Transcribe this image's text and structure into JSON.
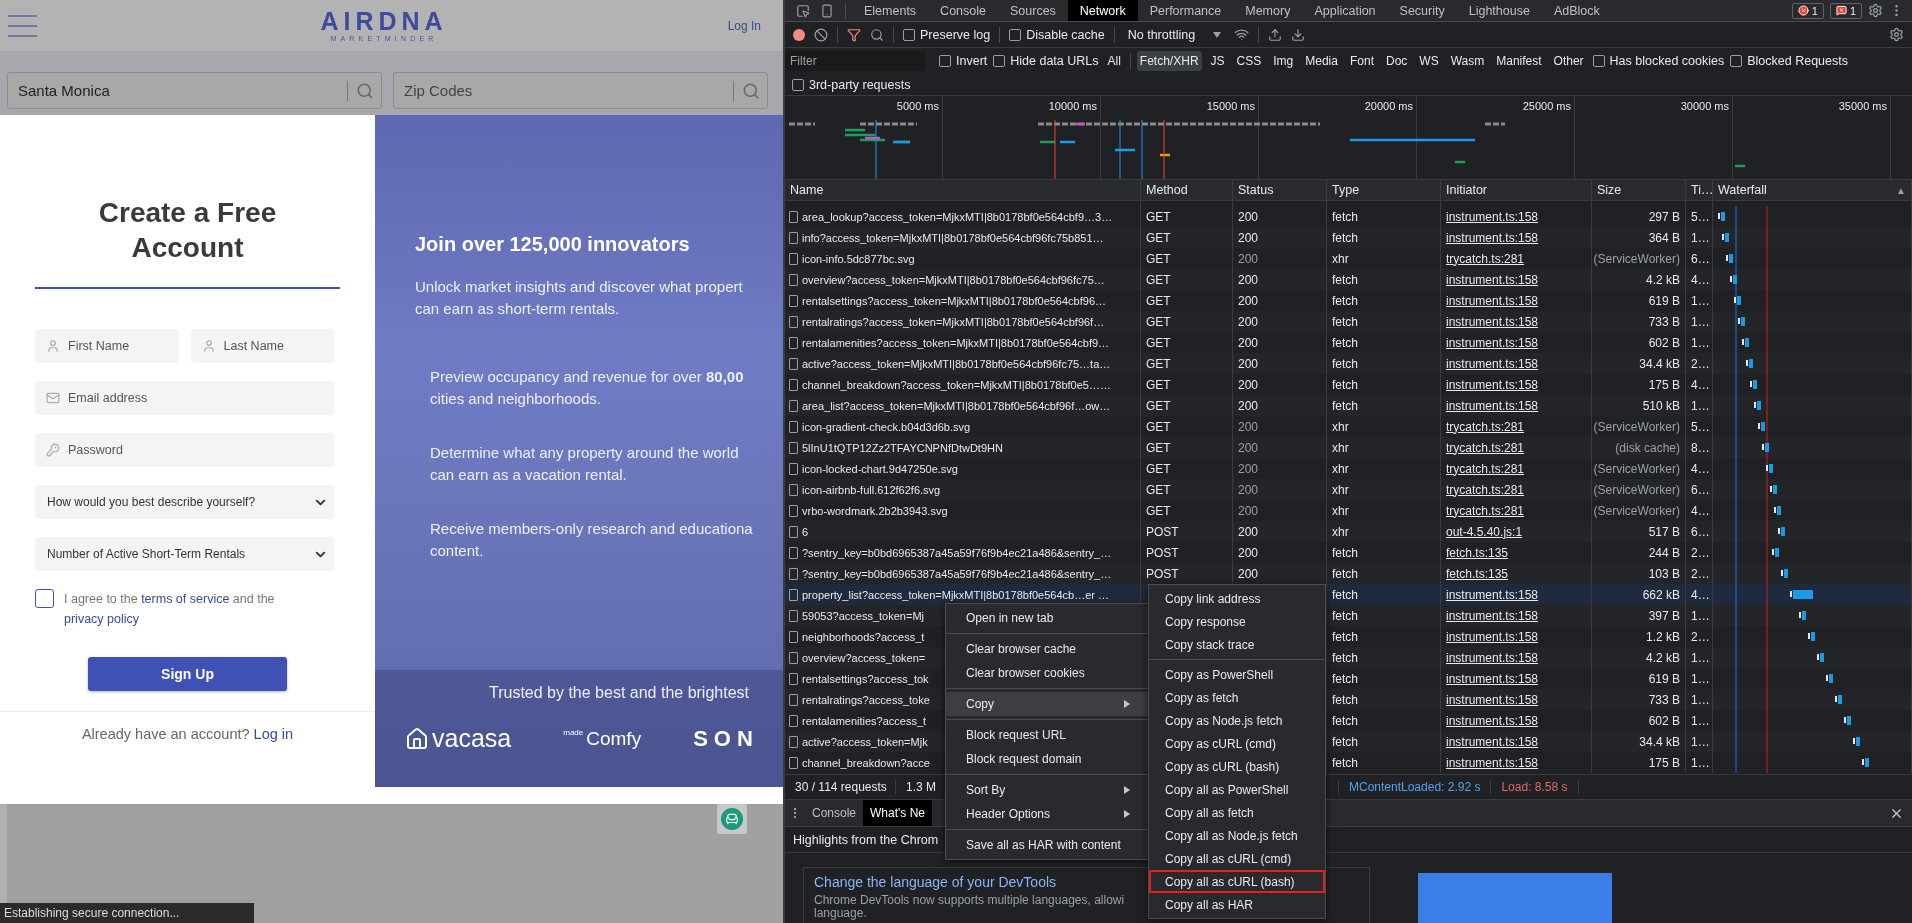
{
  "page": {
    "header": {
      "logo": "AIRDNA",
      "logo_tagline": "MARKETMINDER",
      "login": "Log In"
    },
    "searches": [
      {
        "value": "Santa Monica"
      },
      {
        "placeholder": "Zip Codes"
      }
    ],
    "signup": {
      "title": "Create a Free Account",
      "fields": [
        {
          "kind": "person",
          "placeholder": "First Name"
        },
        {
          "kind": "person",
          "placeholder": "Last Name"
        },
        {
          "kind": "email",
          "placeholder": "Email address"
        },
        {
          "kind": "password",
          "placeholder": "Password"
        }
      ],
      "selects": [
        "How would you best describe yourself?",
        "Number of Active Short-Term Rentals"
      ],
      "agreement": {
        "checked": false,
        "parts": [
          {
            "kind": "text",
            "text": "I agree to the "
          },
          {
            "kind": "link",
            "text": "terms of service"
          },
          {
            "kind": "text",
            "text": " and the "
          },
          {
            "kind": "link",
            "text": "privacy policy"
          }
        ]
      },
      "button": "Sign Up",
      "login_prompt": "Already have an account?",
      "login_link": "Log in"
    },
    "hero": {
      "title": "Join over 125,000 innovators",
      "intro": [
        "Unlock market insights and discover what propert",
        "can earn as short-term rentals."
      ],
      "points": [
        {
          "lines": [
            "Preview occupancy and revenue for over **80,00**",
            "cities and neighborhoods."
          ]
        },
        {
          "lines": [
            "Determine what any property around the world",
            "can earn as a vacation rental."
          ]
        },
        {
          "lines": [
            "Receive members-only research and educationa",
            "content."
          ]
        }
      ],
      "trusted": "Trusted by the best and the brightest",
      "logos": [
        {
          "kind": "house",
          "text": "vacasa"
        },
        {
          "kind": "made",
          "small": "made",
          "text": "Comfy"
        },
        {
          "kind": "plain",
          "text": "SON"
        }
      ]
    },
    "status": "Establishing secure connection..."
  },
  "devtools": {
    "tabs": [
      {
        "label": "Elements",
        "selected": false
      },
      {
        "label": "Console",
        "selected": false
      },
      {
        "label": "Sources",
        "selected": false
      },
      {
        "label": "Network",
        "selected": true
      },
      {
        "label": "Performance",
        "selected": false
      },
      {
        "label": "Memory",
        "selected": false
      },
      {
        "label": "Application",
        "selected": false
      },
      {
        "label": "Security",
        "selected": false
      },
      {
        "label": "Lighthouse",
        "selected": false
      },
      {
        "label": "AdBlock",
        "selected": false
      }
    ],
    "errors": "1",
    "issues": "1",
    "toolbar": {
      "recording": true,
      "options": [
        {
          "label": "Preserve log",
          "checked": false
        },
        {
          "label": "Disable cache",
          "checked": false
        }
      ],
      "throttling": "No throttling"
    },
    "filter": {
      "placeholder": "Filter",
      "options": [
        {
          "label": "Invert",
          "checked": false
        },
        {
          "label": "Hide data URLs",
          "checked": false
        }
      ],
      "types": [
        {
          "label": "All",
          "selected": false
        },
        {
          "label": "Fetch/XHR",
          "selected": true
        },
        {
          "label": "JS",
          "selected": false
        },
        {
          "label": "CSS",
          "selected": false
        },
        {
          "label": "Img",
          "selected": false
        },
        {
          "label": "Media",
          "selected": false
        },
        {
          "label": "Font",
          "selected": false
        },
        {
          "label": "Doc",
          "selected": false
        },
        {
          "label": "WS",
          "selected": false
        },
        {
          "label": "Wasm",
          "selected": false
        },
        {
          "label": "Manifest",
          "selected": false
        },
        {
          "label": "Other",
          "selected": false
        }
      ],
      "extra": [
        {
          "label": "Has blocked cookies",
          "checked": false
        },
        {
          "label": "Blocked Requests",
          "checked": false
        }
      ],
      "third_party": {
        "label": "3rd-party requests",
        "checked": false
      }
    },
    "overview": {
      "ticks": [
        "5000 ms",
        "10000 ms",
        "15000 ms",
        "20000 ms",
        "25000 ms",
        "30000 ms",
        "35000 ms"
      ]
    },
    "table": {
      "columns": [
        "Name",
        "Method",
        "Status",
        "Type",
        "Initiator",
        "Size",
        "Ti…",
        "Waterfall"
      ],
      "sort_mark": "▲",
      "rows": [
        {
          "name": "area_lookup?access_token=MjkxMTI|8b0178bf0e564cbf9…3…",
          "method": "GET",
          "status": "200",
          "type": "fetch",
          "initiator": "instrument.ts:158",
          "size": "297 B",
          "time": "5…",
          "dimmed": false,
          "selected": false
        },
        {
          "name": "info?access_token=MjkxMTI|8b0178bf0e564cbf96fc75b851…",
          "method": "GET",
          "status": "200",
          "type": "fetch",
          "initiator": "instrument.ts:158",
          "size": "364 B",
          "time": "1…",
          "dimmed": false,
          "selected": false
        },
        {
          "name": "icon-info.5dc877bc.svg",
          "method": "GET",
          "status": "200",
          "type": "xhr",
          "initiator": "trycatch.ts:281",
          "size": "(ServiceWorker)",
          "time": "6…",
          "dimmed": true,
          "selected": false
        },
        {
          "name": "overview?access_token=MjkxMTI|8b0178bf0e564cbf96fc75…",
          "method": "GET",
          "status": "200",
          "type": "fetch",
          "initiator": "instrument.ts:158",
          "size": "4.2 kB",
          "time": "4…",
          "dimmed": false,
          "selected": false
        },
        {
          "name": "rentalsettings?access_token=MjkxMTI|8b0178bf0e564cbf96…",
          "method": "GET",
          "status": "200",
          "type": "fetch",
          "initiator": "instrument.ts:158",
          "size": "619 B",
          "time": "1…",
          "dimmed": false,
          "selected": false
        },
        {
          "name": "rentalratings?access_token=MjkxMTI|8b0178bf0e564cbf96f…",
          "method": "GET",
          "status": "200",
          "type": "fetch",
          "initiator": "instrument.ts:158",
          "size": "733 B",
          "time": "1…",
          "dimmed": false,
          "selected": false
        },
        {
          "name": "rentalamenities?access_token=MjkxMTI|8b0178bf0e564cbf9…",
          "method": "GET",
          "status": "200",
          "type": "fetch",
          "initiator": "instrument.ts:158",
          "size": "602 B",
          "time": "1…",
          "dimmed": false,
          "selected": false
        },
        {
          "name": "active?access_token=MjkxMTI|8b0178bf0e564cbf96fc75…ta…",
          "method": "GET",
          "status": "200",
          "type": "fetch",
          "initiator": "instrument.ts:158",
          "size": "34.4 kB",
          "time": "2…",
          "dimmed": false,
          "selected": false
        },
        {
          "name": "channel_breakdown?access_token=MjkxMTI|8b0178bf0e5……",
          "method": "GET",
          "status": "200",
          "type": "fetch",
          "initiator": "instrument.ts:158",
          "size": "175 B",
          "time": "4…",
          "dimmed": false,
          "selected": false
        },
        {
          "name": "area_list?access_token=MjkxMTI|8b0178bf0e564cbf96f…ow…",
          "method": "GET",
          "status": "200",
          "type": "fetch",
          "initiator": "instrument.ts:158",
          "size": "510 kB",
          "time": "1…",
          "dimmed": false,
          "selected": false
        },
        {
          "name": "icon-gradient-check.b04d3d6b.svg",
          "method": "GET",
          "status": "200",
          "type": "xhr",
          "initiator": "trycatch.ts:281",
          "size": "(ServiceWorker)",
          "time": "5…",
          "dimmed": true,
          "selected": false
        },
        {
          "name": "5lInU1tQTP12Zz2TFAYCNPNfDtwDt9HN",
          "method": "GET",
          "status": "200",
          "type": "xhr",
          "initiator": "trycatch.ts:281",
          "size": "(disk cache)",
          "time": "8…",
          "dimmed": true,
          "selected": false
        },
        {
          "name": "icon-locked-chart.9d47250e.svg",
          "method": "GET",
          "status": "200",
          "type": "xhr",
          "initiator": "trycatch.ts:281",
          "size": "(ServiceWorker)",
          "time": "4…",
          "dimmed": true,
          "selected": false
        },
        {
          "name": "icon-airbnb-full.612f62f6.svg",
          "method": "GET",
          "status": "200",
          "type": "xhr",
          "initiator": "trycatch.ts:281",
          "size": "(ServiceWorker)",
          "time": "6…",
          "dimmed": true,
          "selected": false
        },
        {
          "name": "vrbo-wordmark.2b2b3943.svg",
          "method": "GET",
          "status": "200",
          "type": "xhr",
          "initiator": "trycatch.ts:281",
          "size": "(ServiceWorker)",
          "time": "4…",
          "dimmed": true,
          "selected": false
        },
        {
          "name": "6",
          "method": "POST",
          "status": "200",
          "type": "xhr",
          "initiator": "out-4.5.40.js:1",
          "size": "517 B",
          "time": "6…",
          "dimmed": false,
          "selected": false
        },
        {
          "name": "?sentry_key=b0bd6965387a45a59f76f9b4ec21a486&sentry_…",
          "method": "POST",
          "status": "200",
          "type": "fetch",
          "initiator": "fetch.ts:135",
          "size": "244 B",
          "time": "2…",
          "dimmed": false,
          "selected": false
        },
        {
          "name": "?sentry_key=b0bd6965387a45a59f76f9b4ec21a486&sentry_…",
          "method": "POST",
          "status": "200",
          "type": "fetch",
          "initiator": "fetch.ts:135",
          "size": "103 B",
          "time": "2…",
          "dimmed": false,
          "selected": false
        },
        {
          "name": "property_list?access_token=MjkxMTI|8b0178bf0e564cb…er …",
          "type": "fetch",
          "initiator": "instrument.ts:158",
          "size": "662 kB",
          "time": "4…",
          "dimmed": false,
          "selected": true
        },
        {
          "name": "59053?access_token=Mj",
          "type": "fetch",
          "initiator": "instrument.ts:158",
          "size": "397 B",
          "time": "1…",
          "dimmed": false,
          "selected": false
        },
        {
          "name": "neighborhoods?access_t",
          "type": "fetch",
          "initiator": "instrument.ts:158",
          "size": "1.2 kB",
          "time": "2…",
          "dimmed": false,
          "selected": false
        },
        {
          "name": "overview?access_token=",
          "type": "fetch",
          "initiator": "instrument.ts:158",
          "size": "4.2 kB",
          "time": "1…",
          "dimmed": false,
          "selected": false
        },
        {
          "name": "rentalsettings?access_tok",
          "type": "fetch",
          "initiator": "instrument.ts:158",
          "size": "619 B",
          "time": "1…",
          "dimmed": false,
          "selected": false
        },
        {
          "name": "rentalratings?access_toke",
          "type": "fetch",
          "initiator": "instrument.ts:158",
          "size": "733 B",
          "time": "1…",
          "dimmed": false,
          "selected": false
        },
        {
          "name": "rentalamenities?access_t",
          "type": "fetch",
          "initiator": "instrument.ts:158",
          "size": "602 B",
          "time": "1…",
          "dimmed": false,
          "selected": false
        },
        {
          "name": "active?access_token=Mjk",
          "type": "fetch",
          "initiator": "instrument.ts:158",
          "size": "34.4 kB",
          "time": "1…",
          "dimmed": false,
          "selected": false
        },
        {
          "name": "channel_breakdown?acce",
          "type": "fetch",
          "initiator": "instrument.ts:158",
          "size": "175 B",
          "time": "1…",
          "dimmed": false,
          "selected": false
        }
      ]
    },
    "summary": {
      "requests": "30 / 114 requests",
      "transferred": "1.3 M",
      "dom_loaded": "MContentLoaded: 2.92 s",
      "load": "Load: 8.58 s"
    },
    "context_menu": {
      "groups": [
        [
          {
            "label": "Open in new tab",
            "submenu": false,
            "selected": false
          }
        ],
        [
          {
            "label": "Clear browser cache",
            "submenu": false,
            "selected": false
          },
          {
            "label": "Clear browser cookies",
            "submenu": false,
            "selected": false
          }
        ],
        [
          {
            "label": "Copy",
            "submenu": true,
            "selected": true
          }
        ],
        [
          {
            "label": "Block request URL",
            "submenu": false,
            "selected": false
          },
          {
            "label": "Block request domain",
            "submenu": false,
            "selected": false
          }
        ],
        [
          {
            "label": "Sort By",
            "submenu": true,
            "selected": false
          },
          {
            "label": "Header Options",
            "submenu": true,
            "selected": false
          }
        ],
        [
          {
            "label": "Save all as HAR with content",
            "submenu": false,
            "selected": false
          }
        ]
      ]
    },
    "copy_menu": {
      "groups": [
        [
          {
            "label": "Copy link address",
            "outlined": false
          },
          {
            "label": "Copy response",
            "outlined": false
          },
          {
            "label": "Copy stack trace",
            "outlined": false
          }
        ],
        [
          {
            "label": "Copy as PowerShell",
            "outlined": false
          },
          {
            "label": "Copy as fetch",
            "outlined": false
          },
          {
            "label": "Copy as Node.js fetch",
            "outlined": false
          },
          {
            "label": "Copy as cURL (cmd)",
            "outlined": false
          },
          {
            "label": "Copy as cURL (bash)",
            "outlined": false
          },
          {
            "label": "Copy all as PowerShell",
            "outlined": false
          },
          {
            "label": "Copy all as fetch",
            "outlined": false
          },
          {
            "label": "Copy all as Node.js fetch",
            "outlined": false
          },
          {
            "label": "Copy all as cURL (cmd)",
            "outlined": false
          },
          {
            "label": "Copy all as cURL (bash)",
            "outlined": true
          },
          {
            "label": "Copy all as HAR",
            "outlined": false
          }
        ]
      ]
    },
    "drawer": {
      "tabs": [
        {
          "label": "Console",
          "selected": false
        },
        {
          "label": "What's Ne",
          "selected": true
        }
      ],
      "heading": "Highlights from the Chrom",
      "card": {
        "title": "Change the language of your DevTools",
        "body": [
          "Chrome DevTools now supports multiple languages, allowi",
          "language."
        ]
      }
    }
  }
}
